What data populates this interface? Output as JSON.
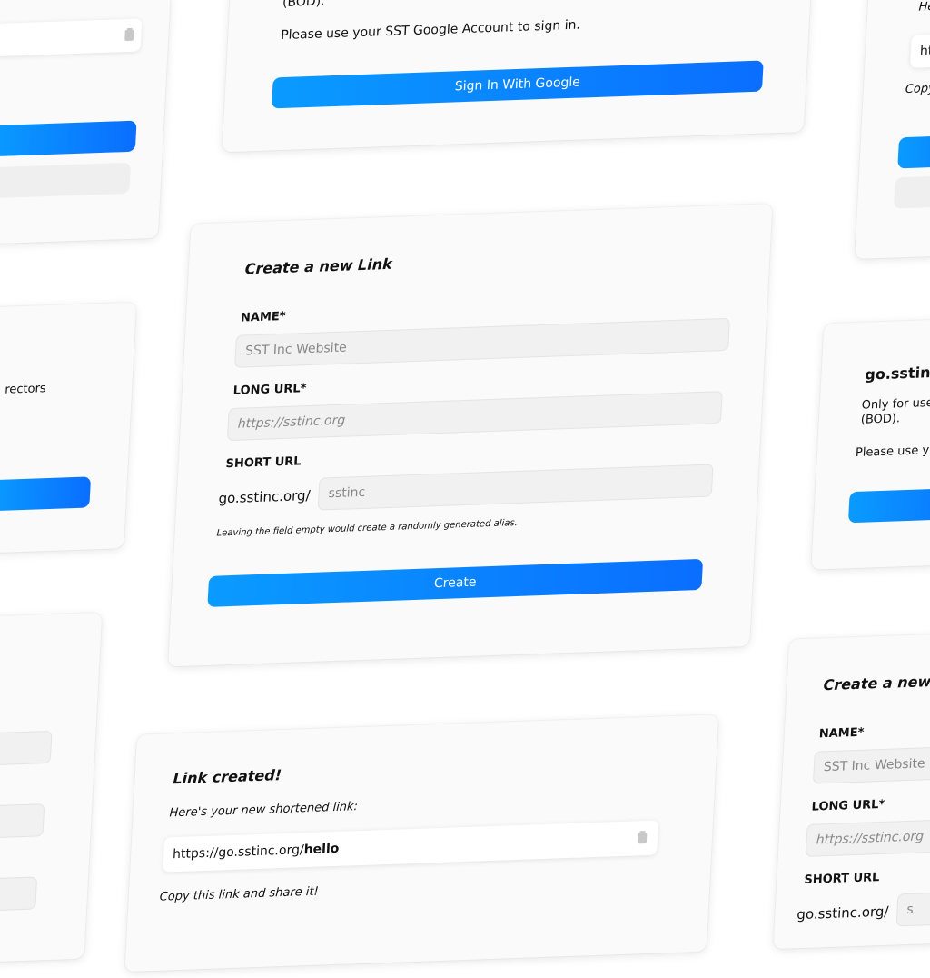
{
  "signin": {
    "bod_fragment": "(BOD).",
    "instruction": "Please use your SST Google Account to sign in.",
    "button_label": "Sign In With Google"
  },
  "create_form": {
    "title": "Create a new Link",
    "name_label": "NAME*",
    "name_placeholder": "SST Inc Website",
    "long_url_label": "LONG URL*",
    "long_url_placeholder": "https://sstinc.org",
    "short_url_label": "SHORT URL",
    "short_url_prefix": "go.sstinc.org/",
    "short_url_placeholder": "sstinc",
    "hint": "Leaving the field empty would create a randomly generated alias.",
    "button_label": "Create"
  },
  "link_created": {
    "title": "Link created!",
    "subtitle": "Here's your new shortened link:",
    "link_base": "https://go.sstinc.org/",
    "link_alias": "hello",
    "share_text": "Copy this link and share it!"
  },
  "right_top_card": {
    "here_fragment": "Here's",
    "link_fragment": "http",
    "copy_fragment": "Copy th"
  },
  "right_middle_card": {
    "title_fragment": "go.sstinc",
    "line1_fragment": "Only for use",
    "line2_fragment": "(BOD).",
    "line3_fragment": "Please use y"
  },
  "right_bottom_card": {
    "title_fragment": "Create a new",
    "name_label": "NAME*",
    "name_placeholder_fragment": "SST Inc Website",
    "long_url_label": "LONG URL*",
    "long_url_placeholder_fragment": "https://sstinc.org",
    "short_url_label": "SHORT URL",
    "short_url_prefix": "go.sstinc.org/",
    "short_url_placeholder_fragment": "s"
  },
  "left_middle_card": {
    "text_fragment": "rectors"
  }
}
